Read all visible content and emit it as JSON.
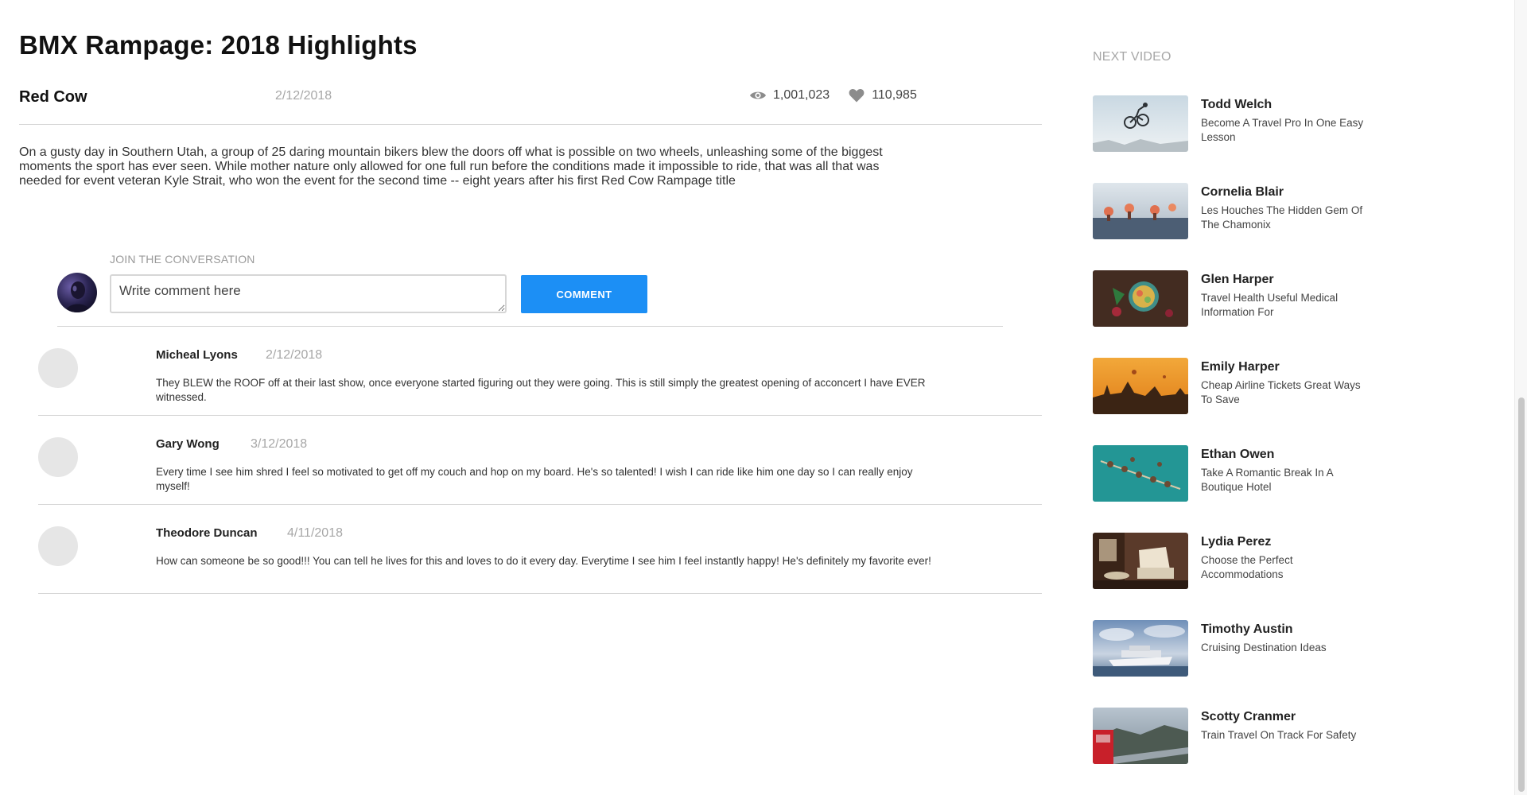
{
  "video": {
    "title": "BMX Rampage: 2018 Highlights",
    "channel": "Red Cow",
    "date": "2/12/2018",
    "views": "1,001,023",
    "likes": "110,985",
    "description": "On a gusty day in Southern Utah, a group of 25 daring mountain bikers blew the doors off what is possible on two wheels, unleashing some of the biggest moments the sport has ever seen. While mother nature only allowed for one full run before the conditions made it impossible to ride, that was all that was needed for event veteran Kyle Strait, who won the event for the second time -- eight years after his first Red Cow Rampage title"
  },
  "icons": {
    "views": "eye-icon",
    "likes": "heart-icon"
  },
  "comment_form": {
    "label": "JOIN THE CONVERSATION",
    "placeholder": "Write comment here",
    "button": "COMMENT"
  },
  "comments": [
    {
      "author": "Micheal Lyons",
      "date": "2/12/2018",
      "text": "They BLEW the ROOF off at their last show, once everyone started figuring out they were going. This is still simply the greatest opening of acconcert I have EVER witnessed."
    },
    {
      "author": "Gary Wong",
      "date": "3/12/2018",
      "text": "Every time I see him shred I feel so motivated to get off my couch and hop on my board. He's so talented! I wish I can ride like him one day so I can really enjoy myself!"
    },
    {
      "author": "Theodore Duncan",
      "date": "4/11/2018",
      "text": "How can someone be so good!!! You can tell he lives for this and loves to do it every day. Everytime I see him I feel instantly happy! He's definitely my favorite ever!"
    }
  ],
  "next_video": {
    "label": "NEXT VIDEO",
    "items": [
      {
        "author": "Todd Welch",
        "title": "Become A Travel Pro In One Easy Lesson"
      },
      {
        "author": "Cornelia Blair",
        "title": "Les Houches The Hidden Gem Of The Chamonix"
      },
      {
        "author": "Glen Harper",
        "title": "Travel Health Useful Medical Information For"
      },
      {
        "author": "Emily Harper",
        "title": "Cheap Airline Tickets Great Ways To Save"
      },
      {
        "author": "Ethan Owen",
        "title": "Take A Romantic Break In A Boutique Hotel"
      },
      {
        "author": "Lydia Perez",
        "title": "Choose the Perfect Accommodations"
      },
      {
        "author": "Timothy Austin",
        "title": "Cruising Destination Ideas"
      },
      {
        "author": "Scotty Cranmer",
        "title": "Train Travel On Track For Safety"
      }
    ]
  }
}
